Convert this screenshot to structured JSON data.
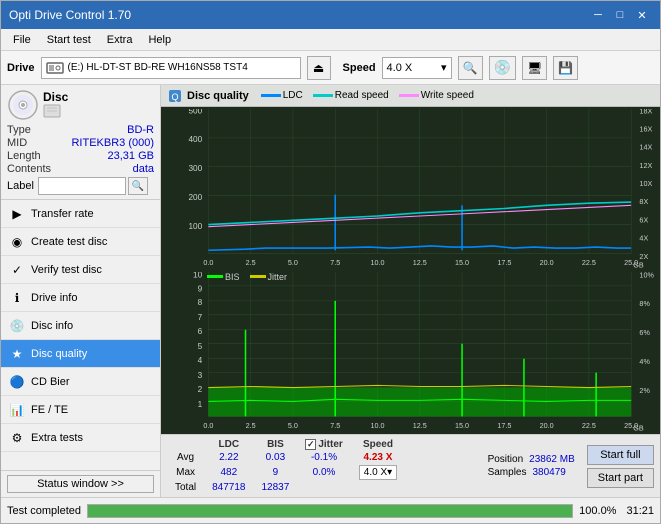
{
  "titlebar": {
    "title": "Opti Drive Control 1.70",
    "min": "─",
    "max": "□",
    "close": "✕"
  },
  "menubar": {
    "items": [
      "File",
      "Start test",
      "Extra",
      "Help"
    ]
  },
  "toolbar": {
    "drive_label": "Drive",
    "drive_value": "(E:)  HL-DT-ST BD-RE  WH16NS58 TST4",
    "speed_label": "Speed",
    "speed_value": "4.0 X"
  },
  "disc": {
    "title": "Disc",
    "type_label": "Type",
    "type_value": "BD-R",
    "mid_label": "MID",
    "mid_value": "RITEKBR3 (000)",
    "length_label": "Length",
    "length_value": "23,31 GB",
    "contents_label": "Contents",
    "contents_value": "data",
    "label_label": "Label",
    "label_value": ""
  },
  "nav": {
    "items": [
      {
        "id": "transfer-rate",
        "label": "Transfer rate",
        "icon": "▶"
      },
      {
        "id": "create-test-disc",
        "label": "Create test disc",
        "icon": "◉"
      },
      {
        "id": "verify-test-disc",
        "label": "Verify test disc",
        "icon": "✓"
      },
      {
        "id": "drive-info",
        "label": "Drive info",
        "icon": "ℹ"
      },
      {
        "id": "disc-info",
        "label": "Disc info",
        "icon": "💿"
      },
      {
        "id": "disc-quality",
        "label": "Disc quality",
        "icon": "★",
        "active": true
      },
      {
        "id": "cd-bier",
        "label": "CD Bier",
        "icon": "🔵"
      },
      {
        "id": "fe-te",
        "label": "FE / TE",
        "icon": "📊"
      },
      {
        "id": "extra-tests",
        "label": "Extra tests",
        "icon": "⚙"
      }
    ]
  },
  "status_window_btn": "Status window >>",
  "chart": {
    "title": "Disc quality",
    "legend_ldc": "LDC",
    "legend_read": "Read speed",
    "legend_write": "Write speed",
    "legend_bis": "BIS",
    "legend_jitter": "Jitter",
    "top_y_max": "500",
    "top_y_marks": [
      "500",
      "400",
      "300",
      "200",
      "100"
    ],
    "top_x_marks": [
      "0.0",
      "2.5",
      "5.0",
      "7.5",
      "10.0",
      "12.5",
      "15.0",
      "17.5",
      "20.0",
      "22.5",
      "25.0"
    ],
    "top_y2_marks": [
      "18X",
      "16X",
      "14X",
      "12X",
      "10X",
      "8X",
      "6X",
      "4X",
      "2X"
    ],
    "bot_y_max": "10",
    "bot_y_marks": [
      "10",
      "9",
      "8",
      "7",
      "6",
      "5",
      "4",
      "3",
      "2",
      "1"
    ],
    "bot_x_marks": [
      "0.0",
      "2.5",
      "5.0",
      "7.5",
      "10.0",
      "12.5",
      "15.0",
      "17.5",
      "20.0",
      "22.5",
      "25.0"
    ],
    "bot_y2_marks": [
      "10%",
      "8%",
      "6%",
      "4%",
      "2%"
    ],
    "gb_label": "GB"
  },
  "stats": {
    "ldc_header": "LDC",
    "bis_header": "BIS",
    "jitter_header": "Jitter",
    "speed_header": "Speed",
    "avg_label": "Avg",
    "max_label": "Max",
    "total_label": "Total",
    "ldc_avg": "2.22",
    "ldc_max": "482",
    "ldc_total": "847718",
    "bis_avg": "0.03",
    "bis_max": "9",
    "bis_total": "12837",
    "jitter_avg": "-0.1%",
    "jitter_max": "0.0%",
    "jitter_checked": true,
    "speed_val": "4.23 X",
    "speed_select": "4.0 X",
    "position_label": "Position",
    "position_val": "23862 MB",
    "samples_label": "Samples",
    "samples_val": "380479",
    "start_full_btn": "Start full",
    "start_part_btn": "Start part"
  },
  "bottom": {
    "status_text": "Test completed",
    "progress": 100,
    "progress_text": "100.0%",
    "time_text": "31:21"
  },
  "colors": {
    "accent_blue": "#3a8ee6",
    "chart_bg": "#1c2b1c",
    "ldc_color": "#00aaff",
    "read_color": "#00ffff",
    "write_color": "#ff00ff",
    "bis_color": "#00ff00",
    "jitter_color": "#ffff00",
    "grid_color": "#2a4a2a"
  }
}
